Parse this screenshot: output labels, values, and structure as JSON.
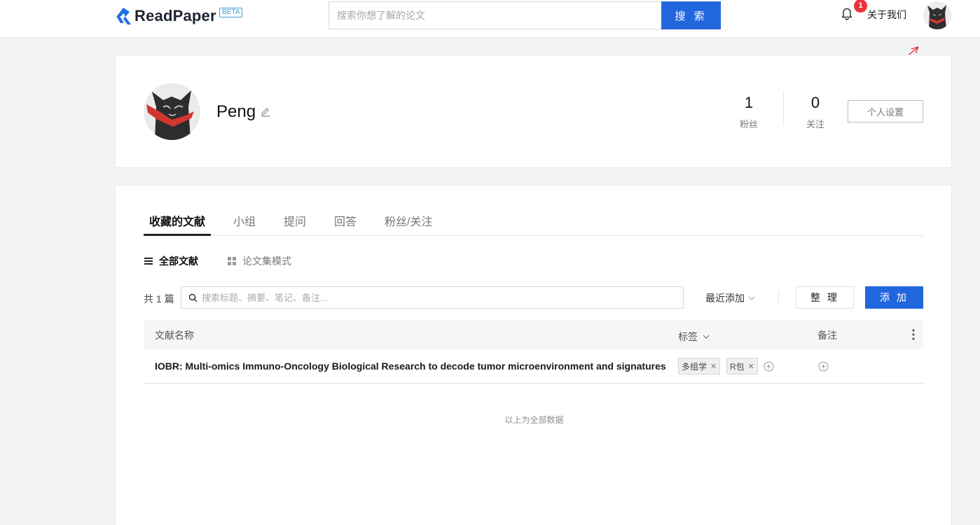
{
  "header": {
    "logo_text": "ReadPaper",
    "beta_label": "BETA",
    "search_placeholder": "搜索你想了解的论文",
    "search_button": "搜 索",
    "notification_count": "1",
    "about_link": "关于我们"
  },
  "profile": {
    "name": "Peng",
    "stats": [
      {
        "value": "1",
        "label": "粉丝"
      },
      {
        "value": "0",
        "label": "关注"
      }
    ],
    "settings_button": "个人设置"
  },
  "tabs": [
    {
      "label": "收藏的文献",
      "active": true
    },
    {
      "label": "小组",
      "active": false
    },
    {
      "label": "提问",
      "active": false
    },
    {
      "label": "回答",
      "active": false
    },
    {
      "label": "粉丝/关注",
      "active": false
    }
  ],
  "view_modes": {
    "all": "全部文献",
    "collection": "论文集模式"
  },
  "library": {
    "count_label": "共 1 篇",
    "search_placeholder": "搜索标题、摘要、笔记、备注...",
    "sort_label": "最近添加",
    "organize_button": "整 理",
    "add_button": "添 加",
    "columns": {
      "name": "文献名称",
      "tags": "标签",
      "notes": "备注"
    },
    "rows": [
      {
        "title": "IOBR: Multi-omics Immuno-Oncology Biological Research to decode tumor microenvironment and signatures",
        "tags": [
          "多组学",
          "R包"
        ]
      }
    ],
    "end_note": "以上为全部数据"
  },
  "colors": {
    "accent": "#2266dd",
    "badge": "#e8323c",
    "annotation": "#e0303a"
  }
}
